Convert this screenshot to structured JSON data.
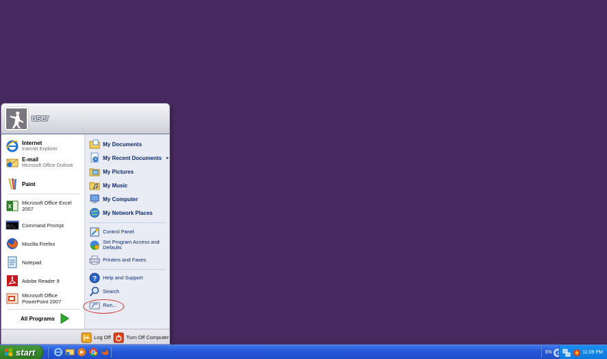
{
  "user": {
    "name": "user"
  },
  "pinned": [
    {
      "title": "Internet",
      "subtitle": "Internet Explorer",
      "icon": "internet-explorer-icon"
    },
    {
      "title": "E-mail",
      "subtitle": "Microsoft Office Outlook",
      "icon": "outlook-icon"
    }
  ],
  "recent": [
    {
      "label": "Paint",
      "icon": "paint-icon"
    },
    {
      "label": "Microsoft Office Excel 2007",
      "icon": "excel-icon"
    },
    {
      "label": "Command Prompt",
      "icon": "command-prompt-icon"
    },
    {
      "label": "Mozilla Firefox",
      "icon": "firefox-icon"
    },
    {
      "label": "Notepad",
      "icon": "notepad-icon"
    },
    {
      "label": "Adobe Reader 9",
      "icon": "adobe-reader-icon"
    },
    {
      "label": "Microsoft Office PowerPoint 2007",
      "icon": "powerpoint-icon"
    }
  ],
  "all_programs": {
    "label": "All Programs",
    "icon": "green-arrow-icon"
  },
  "places": [
    {
      "label": "My Documents",
      "icon": "my-documents-icon"
    },
    {
      "label": "My Recent Documents",
      "icon": "my-recent-documents-icon",
      "submenu_arrow": "▸"
    },
    {
      "label": "My Pictures",
      "icon": "my-pictures-icon"
    },
    {
      "label": "My Music",
      "icon": "my-music-icon"
    },
    {
      "label": "My Computer",
      "icon": "my-computer-icon"
    },
    {
      "label": "My Network Places",
      "icon": "my-network-places-icon"
    }
  ],
  "settings": [
    {
      "label": "Control Panel",
      "icon": "control-panel-icon"
    },
    {
      "label": "Set Program Access and Defaults",
      "icon": "program-access-icon"
    },
    {
      "label": "Printers and Faxes",
      "icon": "printers-icon"
    }
  ],
  "tools": [
    {
      "label": "Help and Support",
      "icon": "help-icon"
    },
    {
      "label": "Search",
      "icon": "search-icon"
    },
    {
      "label": "Run...",
      "icon": "run-icon"
    }
  ],
  "footer": {
    "log_off": "Log Off",
    "turn_off": "Turn Off Computer"
  },
  "taskbar": {
    "start_label": "start",
    "quick_launch": [
      "internet-explorer-icon",
      "outlook-icon",
      "media-player-icon",
      "chrome-icon",
      "firefox-icon"
    ],
    "language": "EN",
    "clock": "11:09 PM"
  },
  "colors": {
    "desktop": "#46295f",
    "taskbar": "#2456d8",
    "start_button": "#358a2a",
    "tray": "#0f78dc",
    "places_panel": "#e9ecf5",
    "highlight_circle": "#d83030"
  }
}
